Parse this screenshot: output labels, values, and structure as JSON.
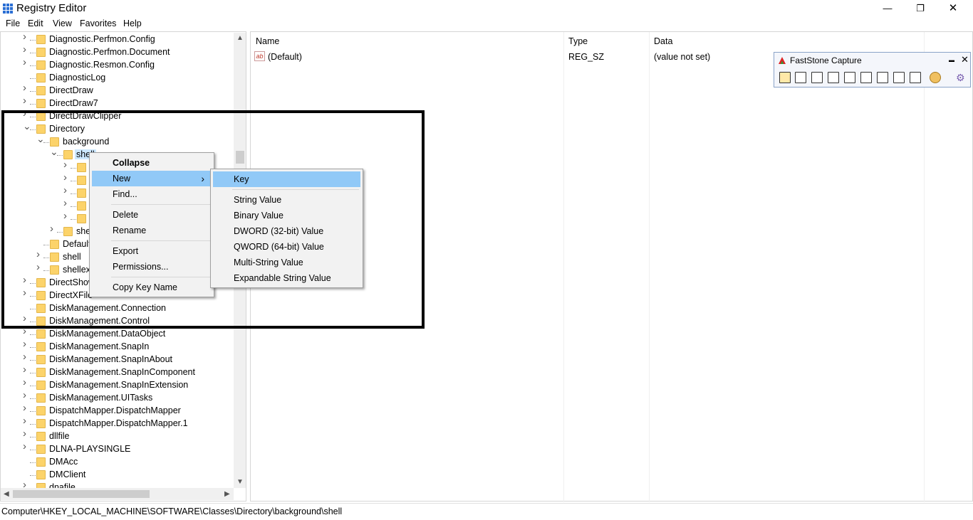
{
  "window": {
    "title": "Registry Editor"
  },
  "window_controls": {
    "minimize": "—",
    "maximize": "❐",
    "close": "✕"
  },
  "menu": [
    "File",
    "Edit",
    "View",
    "Favorites",
    "Help"
  ],
  "tree": [
    {
      "label": "Diagnostic.Perfmon.Config",
      "level": 1,
      "exp": ">"
    },
    {
      "label": "Diagnostic.Perfmon.Document",
      "level": 1,
      "exp": ">"
    },
    {
      "label": "Diagnostic.Resmon.Config",
      "level": 1,
      "exp": ">"
    },
    {
      "label": "DiagnosticLog",
      "level": 1,
      "exp": ""
    },
    {
      "label": "DirectDraw",
      "level": 1,
      "exp": ">"
    },
    {
      "label": "DirectDraw7",
      "level": 1,
      "exp": ">"
    },
    {
      "label": "DirectDrawClipper",
      "level": 1,
      "exp": ">"
    },
    {
      "label": "Directory",
      "level": 1,
      "exp": "v"
    },
    {
      "label": "background",
      "level": 2,
      "exp": "v"
    },
    {
      "label": "shell",
      "level": 3,
      "exp": "v",
      "selected": true
    },
    {
      "label": "",
      "level": 4,
      "exp": ">"
    },
    {
      "label": "",
      "level": 4,
      "exp": ">"
    },
    {
      "label": "",
      "level": 4,
      "exp": ">"
    },
    {
      "label": "",
      "level": 4,
      "exp": ">"
    },
    {
      "label": "",
      "level": 4,
      "exp": ">"
    },
    {
      "label": "she",
      "level": 3,
      "exp": ">"
    },
    {
      "label": "Default",
      "level": 2,
      "exp": ""
    },
    {
      "label": "shell",
      "level": 2,
      "exp": ">"
    },
    {
      "label": "shellex",
      "level": 2,
      "exp": ">"
    },
    {
      "label": "DirectShow",
      "level": 1,
      "exp": ">"
    },
    {
      "label": "DirectXFile",
      "level": 1,
      "exp": ">"
    },
    {
      "label": "DiskManagement.Connection",
      "level": 1,
      "exp": ""
    },
    {
      "label": "DiskManagement.Control",
      "level": 1,
      "exp": ">"
    },
    {
      "label": "DiskManagement.DataObject",
      "level": 1,
      "exp": ">"
    },
    {
      "label": "DiskManagement.SnapIn",
      "level": 1,
      "exp": ">"
    },
    {
      "label": "DiskManagement.SnapInAbout",
      "level": 1,
      "exp": ">"
    },
    {
      "label": "DiskManagement.SnapInComponent",
      "level": 1,
      "exp": ">"
    },
    {
      "label": "DiskManagement.SnapInExtension",
      "level": 1,
      "exp": ">"
    },
    {
      "label": "DiskManagement.UITasks",
      "level": 1,
      "exp": ">"
    },
    {
      "label": "DispatchMapper.DispatchMapper",
      "level": 1,
      "exp": ">"
    },
    {
      "label": "DispatchMapper.DispatchMapper.1",
      "level": 1,
      "exp": ">"
    },
    {
      "label": "dllfile",
      "level": 1,
      "exp": ">"
    },
    {
      "label": "DLNA-PLAYSINGLE",
      "level": 1,
      "exp": ">"
    },
    {
      "label": "DMAcc",
      "level": 1,
      "exp": ""
    },
    {
      "label": "DMClient",
      "level": 1,
      "exp": ""
    },
    {
      "label": "dnafile",
      "level": 1,
      "exp": ">"
    }
  ],
  "list": {
    "headers": {
      "name": "Name",
      "type": "Type",
      "data": "Data"
    },
    "rows": [
      {
        "name": "(Default)",
        "type": "REG_SZ",
        "data": "(value not set)",
        "icon": "ab-string-icon"
      }
    ]
  },
  "context_menu": {
    "items": [
      {
        "label": "Collapse",
        "bold": true
      },
      {
        "label": "New",
        "submenu": true,
        "highlighted": true
      },
      {
        "label": "Find..."
      },
      {
        "sep": true
      },
      {
        "label": "Delete"
      },
      {
        "label": "Rename"
      },
      {
        "sep": true
      },
      {
        "label": "Export"
      },
      {
        "label": "Permissions..."
      },
      {
        "sep": true
      },
      {
        "label": "Copy Key Name"
      }
    ]
  },
  "submenu": {
    "items": [
      {
        "label": "Key",
        "highlighted": true
      },
      {
        "sep": true
      },
      {
        "label": "String Value"
      },
      {
        "label": "Binary Value"
      },
      {
        "label": "DWORD (32-bit) Value"
      },
      {
        "label": "QWORD (64-bit) Value"
      },
      {
        "label": "Multi-String Value"
      },
      {
        "label": "Expandable String Value"
      }
    ]
  },
  "faststone": {
    "title": "FastStone Capture",
    "minimize": "▬",
    "close": "✕",
    "tools": [
      "open-icon",
      "window-capture-icon",
      "object-capture-icon",
      "rectangle-capture-icon",
      "freehand-capture-icon",
      "fullscreen-capture-icon",
      "scrolling-capture-icon",
      "fixed-region-icon",
      "screen-record-icon",
      "output-palette-icon",
      "settings-icon"
    ]
  },
  "status": {
    "path": "Computer\\HKEY_LOCAL_MACHINE\\SOFTWARE\\Classes\\Directory\\background\\shell"
  }
}
